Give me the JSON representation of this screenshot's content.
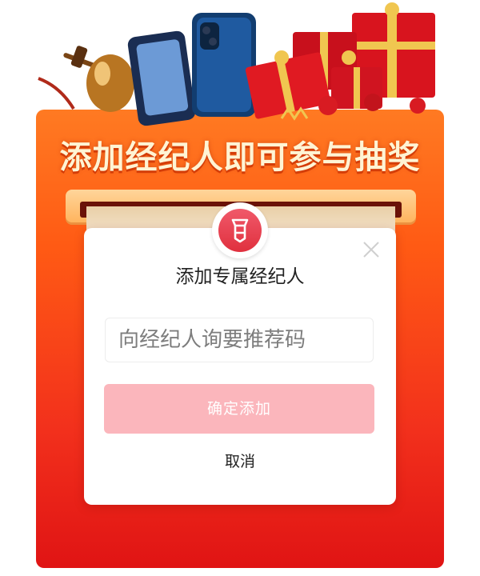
{
  "banner": {
    "title": "添加经纪人即可参与抽奖"
  },
  "dialog": {
    "title": "添加专属经纪人",
    "input_placeholder": "向经纪人询要推荐码",
    "input_value": "",
    "confirm_label": "确定添加",
    "cancel_label": "取消"
  },
  "icons": {
    "badge": "broker-badge-icon",
    "close": "close-icon",
    "prizes": [
      "auction-gavel",
      "golden-egg",
      "smartphone",
      "gift-boxes",
      "ornaments"
    ]
  },
  "colors": {
    "board_top": "#ff7a22",
    "board_bottom": "#e01414",
    "title_text": "#fff4d4",
    "badge": "#e8404e",
    "confirm_button": "#fbb6bc"
  }
}
